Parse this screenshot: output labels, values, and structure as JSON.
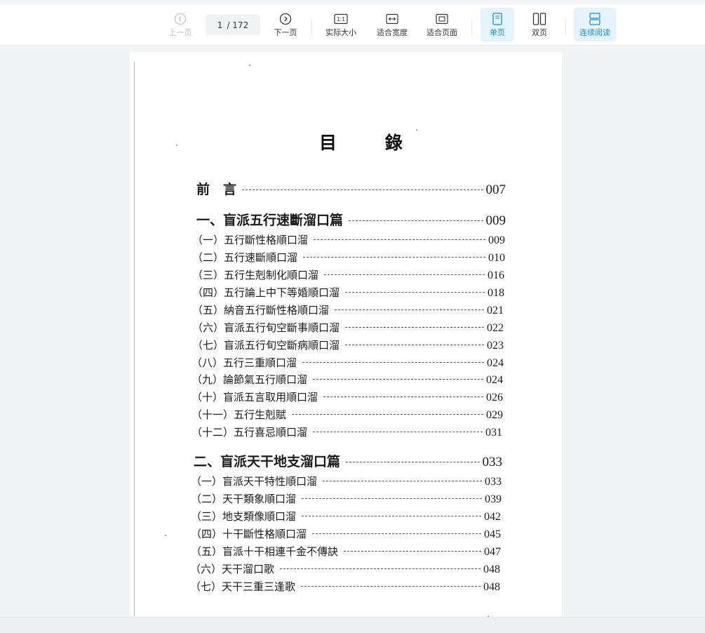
{
  "toolbar": {
    "prev_label": "上一页",
    "next_label": "下一页",
    "page_current": "1",
    "page_total": "/ 172",
    "actual_size_label": "实际大小",
    "actual_size_glyph": "1:1",
    "fit_width_label": "适合宽度",
    "fit_page_label": "适合页面",
    "single_page_label": "单页",
    "double_page_label": "双页",
    "continuous_label": "连续阅读",
    "accent_color": "#1a8fd6",
    "active_bg": "#e4f3fd"
  },
  "document": {
    "title": "目 錄",
    "entries": [
      {
        "text": "前　言",
        "page": "007"
      },
      {
        "text": "一、盲派五行速斷溜口篇",
        "page": "009"
      },
      {
        "text": "（一）五行斷性格順口溜",
        "page": "009"
      },
      {
        "text": "（二）五行速斷順口溜",
        "page": "010"
      },
      {
        "text": "（三）五行生剋制化順口溜",
        "page": "016"
      },
      {
        "text": "（四）五行論上中下等婚順口溜",
        "page": "018"
      },
      {
        "text": "（五）納音五行斷性格順口溜",
        "page": "021"
      },
      {
        "text": "（六）盲派五行旬空斷事順口溜",
        "page": "022"
      },
      {
        "text": "（七）盲派五行旬空斷病順口溜",
        "page": "023"
      },
      {
        "text": "（八）五行三重順口溜",
        "page": "024"
      },
      {
        "text": "（九）論節氣五行順口溜",
        "page": "024"
      },
      {
        "text": "（十）盲派五言取用順口溜",
        "page": "026"
      },
      {
        "text": "（十一）五行生剋賦",
        "page": "029"
      },
      {
        "text": "（十二）五行喜忌順口溜",
        "page": "031"
      },
      {
        "text": "二、盲派天干地支溜口篇",
        "page": "033"
      },
      {
        "text": "（一）盲派天干特性順口溜",
        "page": "033"
      },
      {
        "text": "（二）天干類象順口溜",
        "page": "039"
      },
      {
        "text": "（三）地支類像順口溜",
        "page": "042"
      },
      {
        "text": "（四）十干斷性格順口溜",
        "page": "045"
      },
      {
        "text": "（五）盲派十干相連千金不傳訣",
        "page": "047"
      },
      {
        "text": "（六）天干溜口歌",
        "page": "048"
      },
      {
        "text": "（七）天干三重三逢歌",
        "page": "048"
      }
    ]
  }
}
